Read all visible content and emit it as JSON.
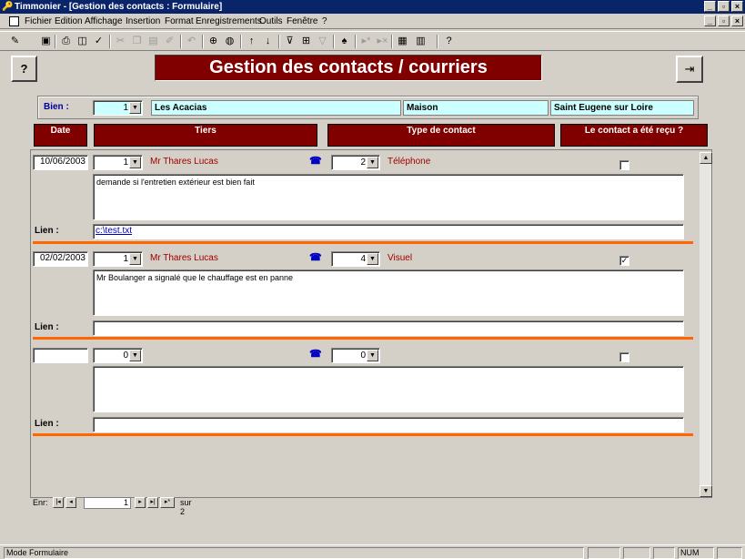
{
  "window": {
    "title": "Timmonier - [Gestion des contacts : Formulaire]",
    "minimize_glyph": "_",
    "restore_glyph": "▫",
    "close_glyph": "×"
  },
  "menu": {
    "items": [
      "Fichier",
      "Edition",
      "Affichage",
      "Insertion",
      "Format",
      "Enregistrements",
      "Outils",
      "Fenêtre",
      "?"
    ]
  },
  "toolbar": {
    "buttons": [
      {
        "name": "design-view-icon",
        "glyph": "✎"
      },
      {
        "name": "save-icon",
        "glyph": "▣"
      },
      {
        "name": "print-icon",
        "glyph": "⎙"
      },
      {
        "name": "print-preview-icon",
        "glyph": "◫"
      },
      {
        "name": "spellcheck-icon",
        "glyph": "✓"
      },
      {
        "name": "cut-icon",
        "glyph": "✂"
      },
      {
        "name": "copy-icon",
        "glyph": "❐"
      },
      {
        "name": "paste-icon",
        "glyph": "▤"
      },
      {
        "name": "format-painter-icon",
        "glyph": "✐"
      },
      {
        "name": "undo-icon",
        "glyph": "↶"
      },
      {
        "name": "insert-hyperlink-icon",
        "glyph": "⊕"
      },
      {
        "name": "web-toolbar-icon",
        "glyph": "◍"
      },
      {
        "name": "sort-ascending-icon",
        "glyph": "↑"
      },
      {
        "name": "sort-descending-icon",
        "glyph": "↓"
      },
      {
        "name": "filter-by-selection-icon",
        "glyph": "⊽"
      },
      {
        "name": "filter-by-form-icon",
        "glyph": "⊞"
      },
      {
        "name": "apply-filter-icon",
        "glyph": "▽"
      },
      {
        "name": "find-icon",
        "glyph": "♠"
      },
      {
        "name": "new-record-icon",
        "glyph": "▸*"
      },
      {
        "name": "delete-record-icon",
        "glyph": "▸×"
      },
      {
        "name": "database-window-icon",
        "glyph": "▦"
      },
      {
        "name": "new-object-icon",
        "glyph": "▥"
      },
      {
        "name": "help-icon",
        "glyph": "?"
      }
    ]
  },
  "form": {
    "help_button_glyph": "?",
    "exit_button_glyph": "⇥",
    "title": "Gestion des contacts / courriers",
    "bien": {
      "label": "Bien :",
      "value": "1",
      "name": "Les Acacias",
      "type": "Maison",
      "city": "Saint Eugene sur Loire"
    },
    "headers": [
      "Date",
      "Tiers",
      "Type de contact",
      "Le contact a été reçu ?"
    ],
    "dropdown_glyph": "▼",
    "phone_glyph": "☎",
    "lien_label": "Lien :",
    "records": [
      {
        "date": "10/06/2003",
        "tiers_id": "1",
        "tiers_name": "Mr Thares Lucas",
        "type_id": "2",
        "type_name": "Téléphone",
        "received": "",
        "comment": "demande si l'entretien extérieur est bien fait",
        "lien": "c:\\test.txt"
      },
      {
        "date": "02/02/2003",
        "tiers_id": "1",
        "tiers_name": "Mr Thares Lucas",
        "type_id": "4",
        "type_name": "Visuel",
        "received": "✓",
        "comment": "Mr Boulanger a signalé que le chauffage est en panne",
        "lien": ""
      },
      {
        "date": "",
        "tiers_id": "0",
        "tiers_name": "",
        "type_id": "0",
        "type_name": "",
        "received": "",
        "comment": "",
        "lien": ""
      }
    ]
  },
  "navigation": {
    "label": "Enr:",
    "first": "|◂",
    "prev": "◂",
    "current": "1",
    "next": "▸",
    "last": "▸|",
    "new": "▸*",
    "total": "sur 2"
  },
  "status": {
    "mode": "Mode Formulaire",
    "num": "NUM"
  }
}
